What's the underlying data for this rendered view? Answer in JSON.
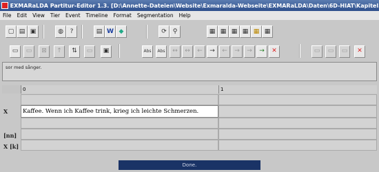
{
  "window": {
    "title": "EXMARaLDA Partitur-Editor 1.3. [D:\\Annette-Dateien\\Website\\Exmaralda-Webseite\\EXMARaLDA\\Daten\\6D-HIAT\\Kapitel5_7..."
  },
  "menu": [
    "File",
    "Edit",
    "View",
    "Tier",
    "Event",
    "Timeline",
    "Format",
    "Segmentation",
    "Help"
  ],
  "edit_line": {
    "text": "sor med sånger."
  },
  "timeline": {
    "points": [
      "0",
      "1"
    ]
  },
  "tiers": [
    {
      "label": "X",
      "events": [
        "Kaffee. Wenn ich Kaffee trink, krieg ich leichte Schmerzen."
      ]
    },
    {
      "label": "[nn]",
      "events": [
        ""
      ]
    },
    {
      "label": "X [k]",
      "events": [
        ""
      ]
    }
  ],
  "status": {
    "text": "Done."
  },
  "toolbar_icons": {
    "abs_label": "Abs",
    "word_label": "W"
  }
}
